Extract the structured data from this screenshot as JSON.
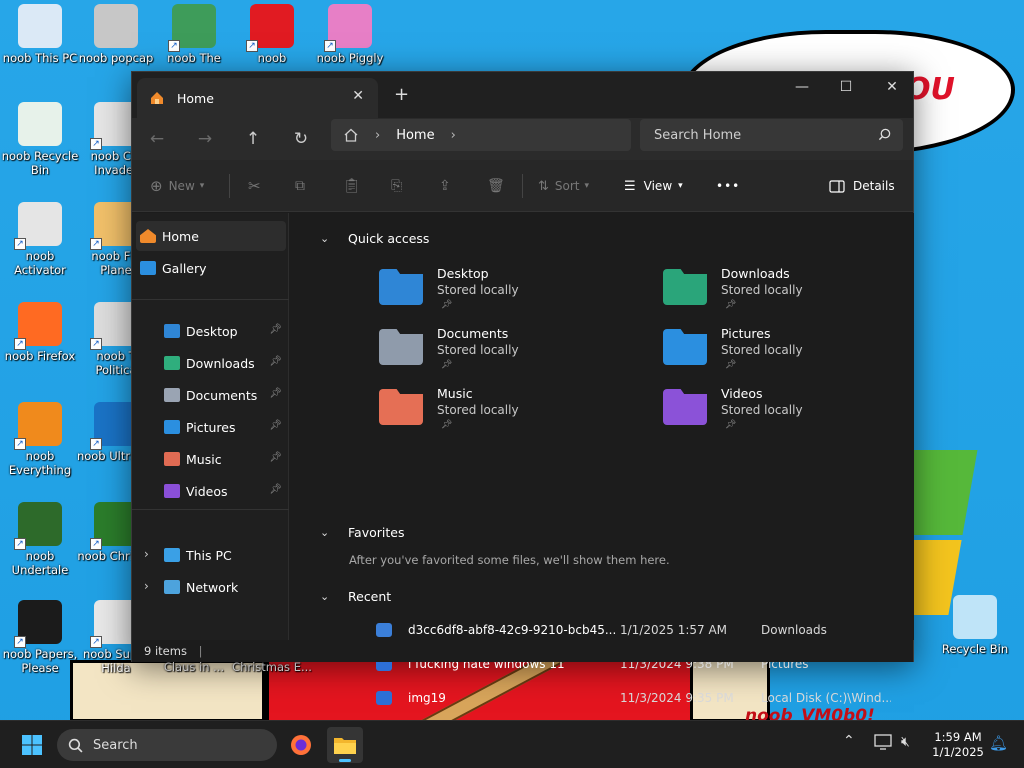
{
  "wallpaper": {
    "cloud_text": "OU",
    "bottom_text": "noob_VM0b0!"
  },
  "desktop_icons": [
    {
      "label": "noob This PC",
      "color": "#dbe9f6"
    },
    {
      "label": "noob popcap",
      "color": "#c7c7c7"
    },
    {
      "label": "noob The",
      "color": "#3e9c5a"
    },
    {
      "label": "noob",
      "color": "#e11b22"
    },
    {
      "label": "noob Piggly",
      "color": "#e77fc6"
    },
    {
      "label": "noob Recycle Bin",
      "color": "#e7f2ea"
    },
    {
      "label": "noob Chi Invader",
      "color": "#e6e6e6"
    },
    {
      "label": "noob Activator",
      "color": "#e5e5e5"
    },
    {
      "label": "noob Fla Plane",
      "color": "#f1c06a"
    },
    {
      "label": "noob Firefox",
      "color": "#ff6a22"
    },
    {
      "label": "noob T Politica",
      "color": "#dddddd"
    },
    {
      "label": "noob Everything",
      "color": "#f08a1c"
    },
    {
      "label": "noob UltraVie",
      "color": "#1a73c6"
    },
    {
      "label": "noob Undertale",
      "color": "#2d6a2a"
    },
    {
      "label": "noob Christm",
      "color": "#2b7d2b"
    },
    {
      "label": "noob Papers, Please",
      "color": "#1b1b1b"
    },
    {
      "label": "noob Super Hilda",
      "color": "#e8e8e8"
    },
    {
      "label": "Recycle Bin",
      "color": "#bfe4f8"
    }
  ],
  "desktop_partial": {
    "a": "Claus in ...",
    "b": "Christmas E..."
  },
  "window": {
    "tab_title": "Home",
    "tab_close": "✕",
    "tab_add": "+",
    "minimize": "—",
    "maximize": "☐",
    "close": "✕",
    "address": "Home",
    "search_placeholder": "Search Home",
    "toolbar": {
      "new": "New",
      "sort": "Sort",
      "view": "View",
      "more": "•••",
      "details": "Details"
    },
    "nav": {
      "home": "Home",
      "gallery": "Gallery",
      "pinned": [
        {
          "label": "Desktop",
          "color": "#2f86d6"
        },
        {
          "label": "Downloads",
          "color": "#2fae7d"
        },
        {
          "label": "Documents",
          "color": "#9aa4b3"
        },
        {
          "label": "Pictures",
          "color": "#2b8fe0"
        },
        {
          "label": "Music",
          "color": "#e06b53"
        },
        {
          "label": "Videos",
          "color": "#8a4fd8"
        }
      ],
      "this_pc": "This PC",
      "network": "Network"
    },
    "quick_access_title": "Quick access",
    "quick_access": [
      {
        "name": "Desktop",
        "sub": "Stored locally",
        "color": "#2f86d6"
      },
      {
        "name": "Downloads",
        "sub": "Stored locally",
        "color": "#2aa57a"
      },
      {
        "name": "Documents",
        "sub": "Stored locally",
        "color": "#8f9bab"
      },
      {
        "name": "Pictures",
        "sub": "Stored locally",
        "color": "#2b8fe0"
      },
      {
        "name": "Music",
        "sub": "Stored locally",
        "color": "#e56f55"
      },
      {
        "name": "Videos",
        "sub": "Stored locally",
        "color": "#8b52d8"
      }
    ],
    "favorites_title": "Favorites",
    "favorites_empty": "After you've favorited some files, we'll show them here.",
    "recent_title": "Recent",
    "recent": [
      {
        "name": "d3cc6df8-abf8-42c9-9210-bcb45...",
        "date": "1/1/2025 1:57 AM",
        "location": "Downloads"
      },
      {
        "name": "i fucking hate windows 11",
        "date": "11/3/2024 9:38 PM",
        "location": "Pictures"
      },
      {
        "name": "img19",
        "date": "11/3/2024 9:35 PM",
        "location": "Local Disk (C:)\\Wind..."
      }
    ],
    "status": "9 items"
  },
  "taskbar": {
    "search": "Search",
    "time": "1:59 AM",
    "date": "1/1/2025"
  }
}
